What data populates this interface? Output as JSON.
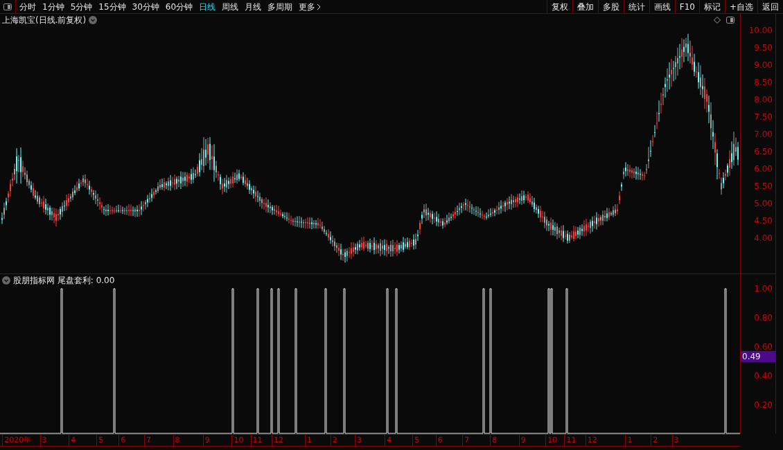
{
  "toolbar": {
    "periods": [
      {
        "label": "分时",
        "selected": false
      },
      {
        "label": "1分钟",
        "selected": false
      },
      {
        "label": "5分钟",
        "selected": false
      },
      {
        "label": "15分钟",
        "selected": false
      },
      {
        "label": "30分钟",
        "selected": false
      },
      {
        "label": "60分钟",
        "selected": false
      },
      {
        "label": "日线",
        "selected": true
      },
      {
        "label": "周线",
        "selected": false
      },
      {
        "label": "月线",
        "selected": false
      },
      {
        "label": "多周期",
        "selected": false
      }
    ],
    "more": "更多",
    "actions": [
      "复权",
      "叠加",
      "多股",
      "统计",
      "画线",
      "F10",
      "标记",
      "+自选",
      "返回"
    ]
  },
  "price_chart": {
    "title": "上海凯宝(日线.前复权)",
    "axis_labels": [
      "10.00",
      "9.50",
      "9.00",
      "8.50",
      "8.00",
      "7.50",
      "7.00",
      "6.50",
      "6.00",
      "5.50",
      "5.00",
      "4.50",
      "4.00"
    ]
  },
  "indicator": {
    "title": "股朋指标网 尾盘套利: 0.00",
    "axis_labels": [
      "1.00",
      "0.80",
      "0.60",
      "0.40",
      "0.20"
    ],
    "current_value": "0.49"
  },
  "date_axis": [
    "2020年",
    "3",
    "4",
    "5",
    "6",
    "7",
    "8",
    "9",
    "10",
    "11",
    "12",
    "1",
    "2",
    "3",
    "4",
    "5",
    "6",
    "7",
    "8",
    "9",
    "10",
    "11",
    "12",
    "1",
    "2",
    "3"
  ]
}
